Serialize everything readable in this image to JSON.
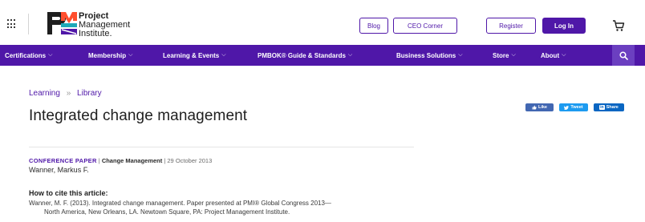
{
  "header": {
    "logo": {
      "line1": "Project",
      "line2": "Management",
      "line3": "Institute."
    },
    "buttons": {
      "blog": "Blog",
      "ceo": "CEO Corner",
      "register": "Register",
      "login": "Log In"
    }
  },
  "nav": {
    "items": [
      {
        "label": "Certifications"
      },
      {
        "label": "Membership"
      },
      {
        "label": "Learning & Events"
      },
      {
        "label": "PMBOK® Guide & Standards"
      },
      {
        "label": "Business Solutions"
      },
      {
        "label": "Store"
      },
      {
        "label": "About"
      }
    ],
    "chevron": "⌵"
  },
  "breadcrumb": {
    "learning": "Learning",
    "separator": "»",
    "library": "Library"
  },
  "page": {
    "title": "Integrated change management"
  },
  "share": {
    "facebook": "Like",
    "twitter": "Tweet",
    "linkedin": "Share"
  },
  "article": {
    "type": "CONFERENCE PAPER",
    "sep": "|",
    "topic": "Change Management",
    "date": "29 October 2013",
    "author": "Wanner, Markus F.",
    "cite_heading": "How to cite this article:",
    "cite_line1": "Wanner, M. F. (2013). Integrated change management. Paper presented at PMI® Global Congress 2013—",
    "cite_line2": "North America, New Orleans, LA. Newtown Square, PA: Project Management Institute."
  },
  "colors": {
    "brand": "#4f17a8",
    "nav_bg": "#4f17a8",
    "search_bg": "#6b3fc0",
    "page_bg": "#d6e6f7"
  },
  "icons": {
    "apps": "grid-icon",
    "cart": "cart-icon",
    "search": "search-icon",
    "logo": "pmi-logo-icon"
  }
}
